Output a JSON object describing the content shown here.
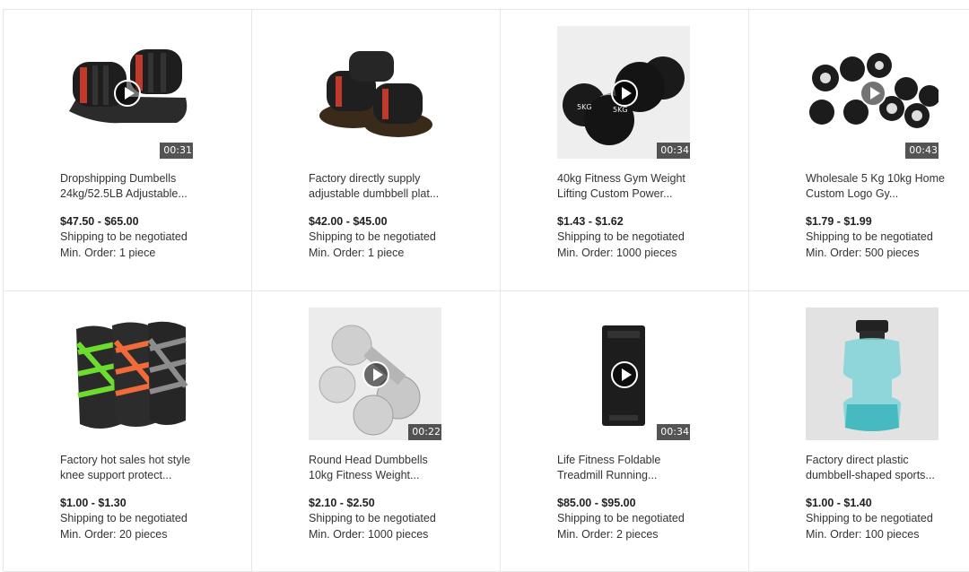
{
  "products": [
    {
      "title": "Dropshipping Dumbells 24kg/52.5LB Adjustable...",
      "price": "$47.50 - $65.00",
      "shipping": "Shipping to be negotiated",
      "min_order": "Min. Order: 1 piece",
      "duration": "00:31",
      "has_video": true
    },
    {
      "title": "Factory directly supply adjustable dumbbell plat...",
      "price": "$42.00 - $45.00",
      "shipping": "Shipping to be negotiated",
      "min_order": "Min. Order: 1 piece",
      "duration": "",
      "has_video": false
    },
    {
      "title": "40kg Fitness Gym Weight Lifting Custom Power...",
      "price": "$1.43 - $1.62",
      "shipping": "Shipping to be negotiated",
      "min_order": "Min. Order: 1000 pieces",
      "duration": "00:34",
      "has_video": true
    },
    {
      "title": "Wholesale 5 Kg 10kg Home Custom Logo Gy...",
      "price": "$1.79 - $1.99",
      "shipping": "Shipping to be negotiated",
      "min_order": "Min. Order: 500 pieces",
      "duration": "00:43",
      "has_video": true
    },
    {
      "title": "Factory hot sales hot style knee support protect...",
      "price": "$1.00 - $1.30",
      "shipping": "Shipping to be negotiated",
      "min_order": "Min. Order: 20 pieces",
      "duration": "",
      "has_video": false
    },
    {
      "title": "Round Head Dumbbells 10kg Fitness Weight...",
      "price": "$2.10 - $2.50",
      "shipping": "Shipping to be negotiated",
      "min_order": "Min. Order: 1000 pieces",
      "duration": "00:22",
      "has_video": true
    },
    {
      "title": "Life Fitness Foldable Treadmill Running...",
      "price": "$85.00 - $95.00",
      "shipping": "Shipping to be negotiated",
      "min_order": "Min. Order: 2 pieces",
      "duration": "00:34",
      "has_video": true
    },
    {
      "title": "Factory direct plastic dumbbell-shaped sports...",
      "price": "$1.00 - $1.40",
      "shipping": "Shipping to be negotiated",
      "min_order": "Min. Order: 100 pieces",
      "duration": "",
      "has_video": false
    }
  ],
  "images": [
    "adjustable-dumbbell-pair",
    "adjustable-dumbbell-set-on-trays",
    "black-rubber-5kg-dumbbells",
    "urethane-dumbbell-set",
    "knee-support-sleeves",
    "chrome-round-head-dumbbells",
    "folded-treadmill",
    "plastic-dumbbell-water-bottle"
  ],
  "colors": {
    "border": "#e6e6e6",
    "text": "#333333",
    "price": "#222222",
    "badge_bg": "#3c3c3c"
  }
}
